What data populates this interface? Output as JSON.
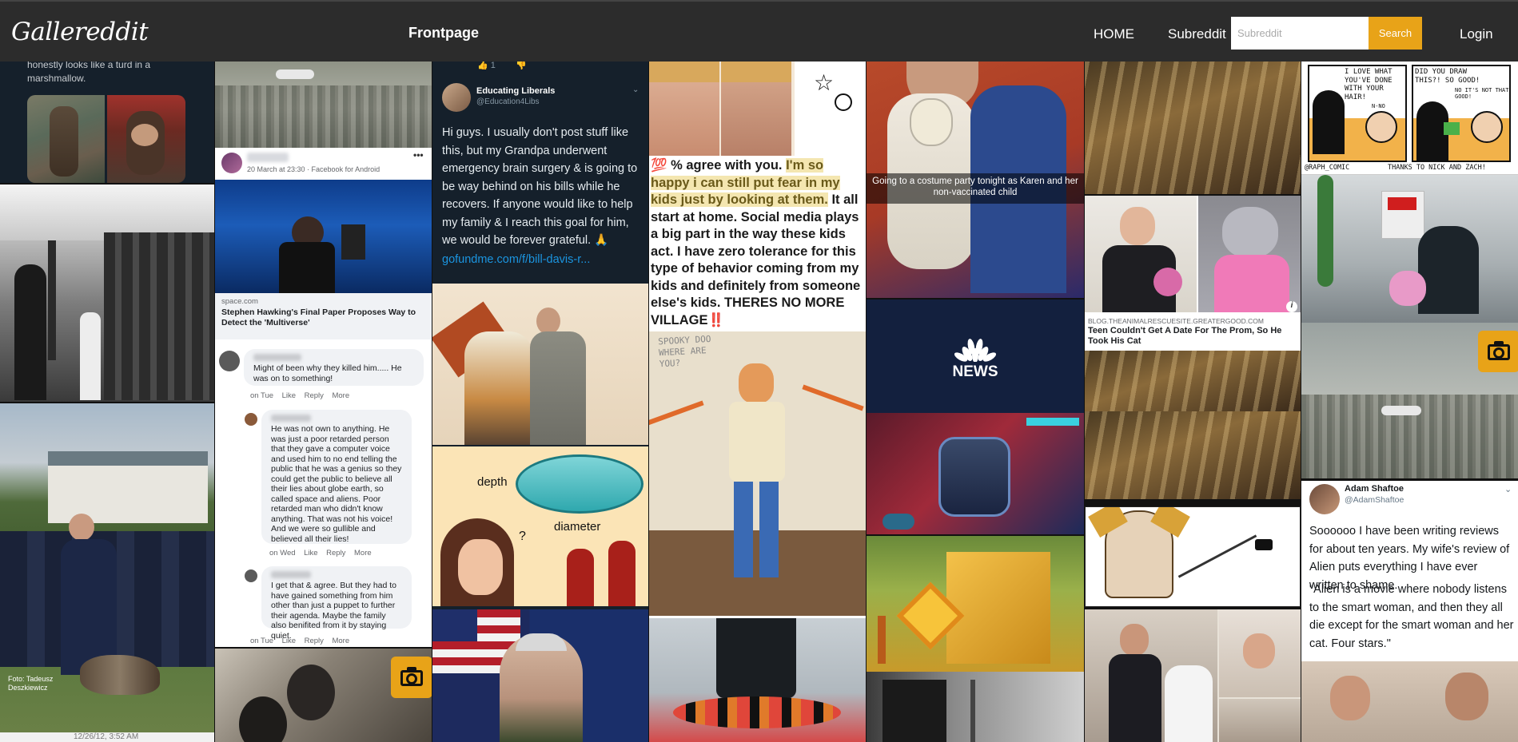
{
  "nav": {
    "logo": "Gallereddit",
    "title": "Frontpage",
    "home": "HOME",
    "subreddit": "Subreddit",
    "search_placeholder": "Subreddit",
    "search_button": "Search",
    "login": "Login"
  },
  "tiles": {
    "marshmallow_text": "honestly looks like a turd in a marshmallow.",
    "fb_post_date": "20 March at 23:30 · Facebook for Android",
    "fb_post_more": "•••",
    "link_domain": "space.com",
    "link_title": "Stephen Hawking's Final Paper Proposes Way to Detect the 'Multiverse'",
    "comments": [
      {
        "text": "Might of been why they killed him..... He was on to something!",
        "meta": "on Tue",
        "like": "Like",
        "reply": "Reply",
        "more": "More"
      },
      {
        "text": "He was not own to anything. He was just a poor retarded person that they gave a computer voice and used him to no end telling the public that he was a genius so they could get the public to believe all their lies about globe earth, so called space and aliens. Poor retarded man who didn't know anything. That was not his voice! And we were so gullible and believed all their lies!",
        "meta": "on Wed",
        "like": "Like",
        "reply": "Reply",
        "more": "More"
      },
      {
        "text": "I get that & agree. But they had to have gained something from him other than just a puppet to further their agenda. Maybe the family also benifited from it by staying quiet.",
        "meta": "on Tue",
        "like": "Like",
        "reply": "Reply",
        "more": "More"
      }
    ],
    "photo_credit": "Foto: Tadeusz\nDeszkiewicz",
    "col1_bottom_date": "12/26/12, 3:52 AM",
    "tweet1_like_count": "1",
    "tweet1_name": "Educating Liberals",
    "tweet1_handle": "@Education4Libs",
    "tweet1_body": "Hi guys. I usually don't post stuff like this, but my Grandpa underwent emergency brain surgery & is going to be way behind on his bills while he recovers. If anyone would like to help my family & I reach this goal for him, we would be forever grateful. 🙏",
    "tweet1_link": "gofundme.com/f/bill-davis-r...",
    "pool_depth": "depth",
    "pool_diameter": "diameter",
    "pool_question": "?",
    "meme_text_prefix": "💯 % agree with you. ",
    "meme_text_highlight": "I'm so happy i can still put fear in my kids just by looking at them.",
    "meme_text_rest": " It all start at home. Social media plays a big part in the way these kids act. I have zero tolerance for this type of behavior coming from my kids and definitely from someone else's kids. THERES NO MORE VILLAGE",
    "meme_text_emoji": "‼️",
    "scooby_sign": "SPOOKY DOO WHERE ARE YOU?",
    "costume_caption": "Going to a costume party tonight as Karen and her non-vaccinated child",
    "nbc_news": "NEWS",
    "cat_domain": "BLOG.THEANIMALRESCUESITE.GREATERGOOD.COM",
    "cat_title": "Teen Couldn't Get A Date For The Prom, So He Took His Cat",
    "comic_panel1": "I LOVE WHAT YOU'VE DONE WITH YOUR HAIR!",
    "comic_panel1b": "N-NO",
    "comic_panel2": "DID YOU DRAW THIS?! SO GOOD!",
    "comic_panel2b": "NO IT'S NOT THAT GOOD!",
    "comic_credit": "@RAPH_COMIC",
    "comic_thanks": "THANKS TO NICK AND ZACH!",
    "tweet2_name": "Adam Shaftoe",
    "tweet2_handle": "@AdamShaftoe",
    "tweet2_body1": "Soooooo I have been writing reviews for about ten years. My wife's review of Alien puts everything I have ever written to shame.",
    "tweet2_body2": "\"Alien is a movie where nobody listens to the smart woman, and then they all die except for the smart woman and her cat. Four stars.\""
  },
  "colors": {
    "accent": "#e8a318",
    "nav_bg": "#2c2c2c",
    "twitter_dark": "#15202b"
  }
}
